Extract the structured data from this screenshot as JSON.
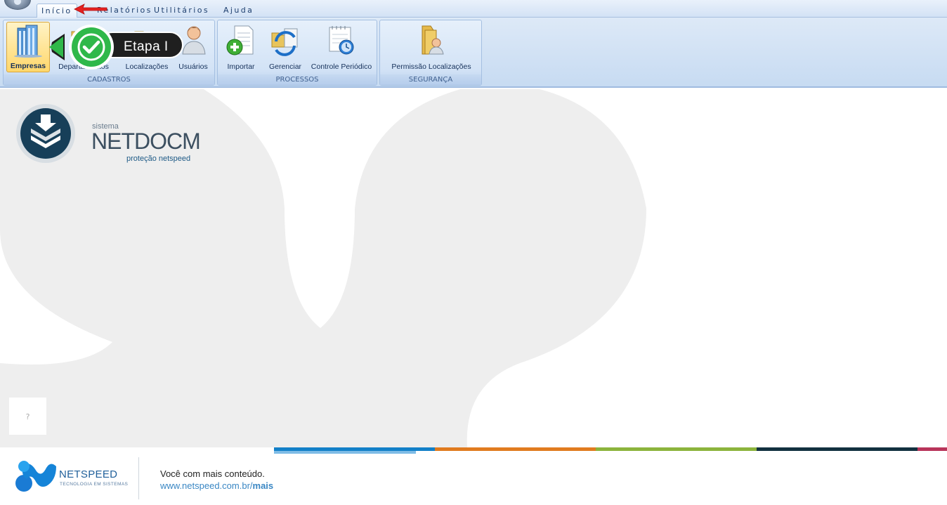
{
  "tabs": {
    "inicio": "Início",
    "relatorios": "Relatórios",
    "utilitarios": "Utilitários",
    "ajuda": "Ajuda"
  },
  "ribbon": {
    "cadastros": {
      "caption": "CADASTROS",
      "empresas": "Empresas",
      "departamentos": "Departamentos",
      "localizacoes": "Localizações",
      "usuarios": "Usuários"
    },
    "processos": {
      "caption": "PROCESSOS",
      "importar": "Importar",
      "gerenciar": "Gerenciar",
      "controle_periodico": "Controle Periódico"
    },
    "seguranca": {
      "caption": "SEGURANÇA",
      "permissao_localizacoes": "Permissão Localizações"
    }
  },
  "callout": {
    "text": "Etapa I"
  },
  "branding": {
    "small": "sistema",
    "name": "NETDOCM",
    "tagline": "proteção netspeed"
  },
  "help": {
    "label": "?"
  },
  "footer": {
    "company": "NETSPEED",
    "company_sub": "TECNOLOGIA EM SISTEMAS",
    "slogan": "Você com mais conteúdo.",
    "url_base": "www.netspeed.com.br/",
    "url_path": "mais"
  },
  "colors": {
    "ribbon_bg": "#d3e3f6",
    "selected": "#ffd76b",
    "callout_green": "#2fb84a",
    "callout_dark": "#1f1f1f",
    "stripe_blue": "#1380c8",
    "stripe_orange": "#e07b1f",
    "stripe_green": "#8cb43c",
    "stripe_navy": "#12313f",
    "stripe_red": "#b8355a"
  },
  "icons": {
    "empresas": "buildings-icon",
    "departamentos": "folder-icon",
    "localizacoes": "folder-icon",
    "usuarios": "user-icon",
    "importar": "document-add-icon",
    "gerenciar": "folder-sync-icon",
    "controle_periodico": "calendar-clock-icon",
    "permissao_localizacoes": "folder-user-icon"
  }
}
